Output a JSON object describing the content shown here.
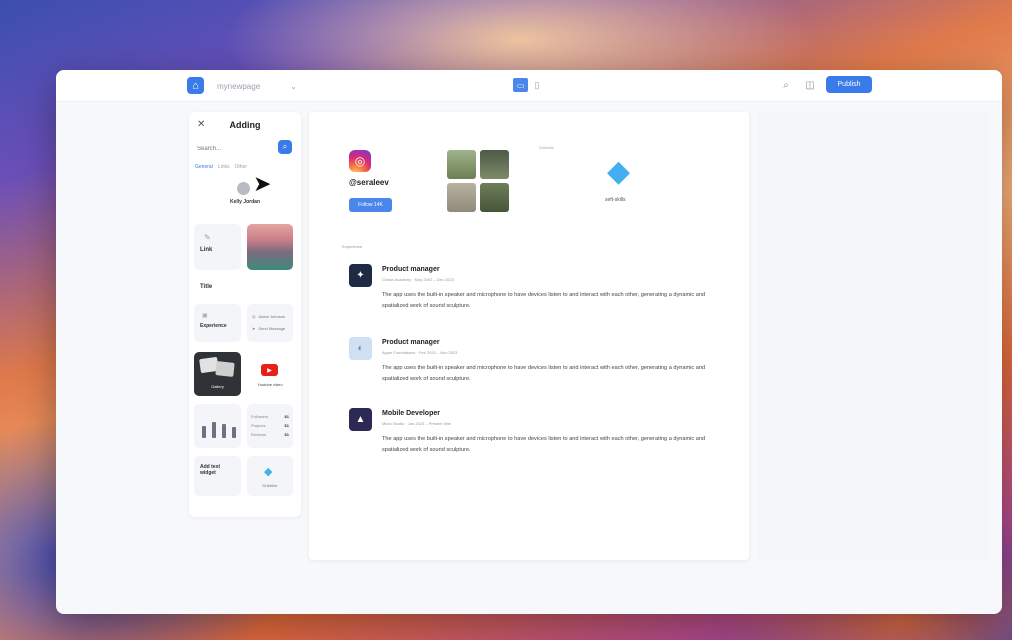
{
  "toolbar": {
    "page_name": "mynewpage",
    "publish_label": "Publish"
  },
  "sidebar": {
    "title": "Adding",
    "search_placeholder": "Search...",
    "tabs": [
      "General",
      "Links",
      "Other"
    ],
    "profile_name": "Kelly Jordan",
    "link_label": "Link",
    "section_title": "Title",
    "experience_label": "Experience",
    "contact_rows": [
      "Adam Johnson",
      "Send Message"
    ],
    "gallery_label": "Gallery",
    "youtube_label": "Youtube video",
    "stats": [
      {
        "label": "Followers",
        "value": "$1"
      },
      {
        "label": "Projects",
        "value": "$1"
      },
      {
        "label": "Reviews",
        "value": "$1"
      }
    ],
    "text_label": "Add text widget",
    "dribbble_label": "Dribbble"
  },
  "canvas": {
    "instagram_handle": "@seraleev",
    "follow_label": "Follow 14K",
    "dribbble_label": "Dribbble",
    "dribbble_sub": "seft-skills",
    "experience_label": "Experience",
    "experience": [
      {
        "title": "Product manager",
        "meta": "Chase Academy · May 2002 – Dec 2023",
        "desc": "The app uses the built-in speaker and microphone to have devices listen to and interact with each other, generating a dynamic and spatialized work of sound sculpture.",
        "logo_color": "#1f2a44"
      },
      {
        "title": "Product manager",
        "meta": "Apple Foundations · Feb 2020 – Nov 2023",
        "desc": "The app uses the built-in speaker and microphone to have devices listen to and interact with each other, generating a dynamic and spatialized work of sound sculpture.",
        "logo_color": "#cfe0f3"
      },
      {
        "title": "Mobile Developer",
        "meta": "Micro Studio · Jun 2023 – Present time",
        "desc": "The app uses the built-in speaker and microphone to have devices listen to and interact with each other, generating a dynamic and spatialized work of sound sculpture.",
        "logo_color": "#2c2a55"
      }
    ]
  },
  "colors": {
    "accent": "#3a7bea",
    "instagram": "#d6297b",
    "youtube": "#e62117",
    "dribbble": "#45aef0"
  }
}
